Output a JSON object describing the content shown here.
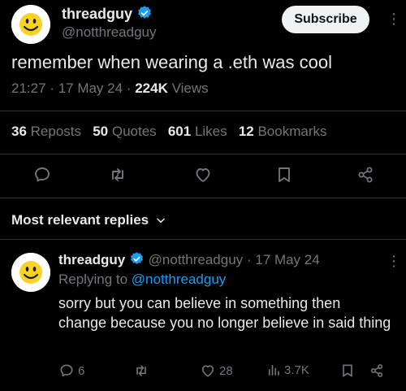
{
  "post": {
    "display_name": "threadguy",
    "handle": "@notthreadguy",
    "subscribe_label": "Subscribe",
    "more_label": "⋮",
    "text": "remember when wearing a .eth was cool",
    "time": "21:27",
    "date": "17 May 24",
    "views_count": "224K",
    "views_label": "Views",
    "separator": "·"
  },
  "stats": {
    "reposts_count": "36",
    "reposts_label": "Reposts",
    "quotes_count": "50",
    "quotes_label": "Quotes",
    "likes_count": "601",
    "likes_label": "Likes",
    "bookmarks_count": "12",
    "bookmarks_label": "Bookmarks"
  },
  "replies_header": {
    "label": "Most relevant replies"
  },
  "reply": {
    "display_name": "threadguy",
    "handle": "@notthreadguy",
    "separator": "·",
    "date": "17 May 24",
    "replying_prefix": "Replying to",
    "replying_handle": "@notthreadguy",
    "text": "sorry but you can believe in something then change because you no longer believe in said thing",
    "comments_count": "6",
    "likes_count": "28",
    "views_count": "3.7K",
    "more_label": "⋮"
  },
  "colors": {
    "background": "#000000",
    "text": "#e7e9ea",
    "muted": "#71767b",
    "accent": "#1d9bf0",
    "divider": "#2f3336"
  },
  "icons": {
    "verified": "verified-badge-icon",
    "reply": "comment-bubble-icon",
    "repost": "repost-arrows-icon",
    "like": "heart-icon",
    "bookmark": "bookmark-icon",
    "share": "share-nodes-icon",
    "views": "bar-chart-icon",
    "dropdown": "chevron-down-icon"
  }
}
